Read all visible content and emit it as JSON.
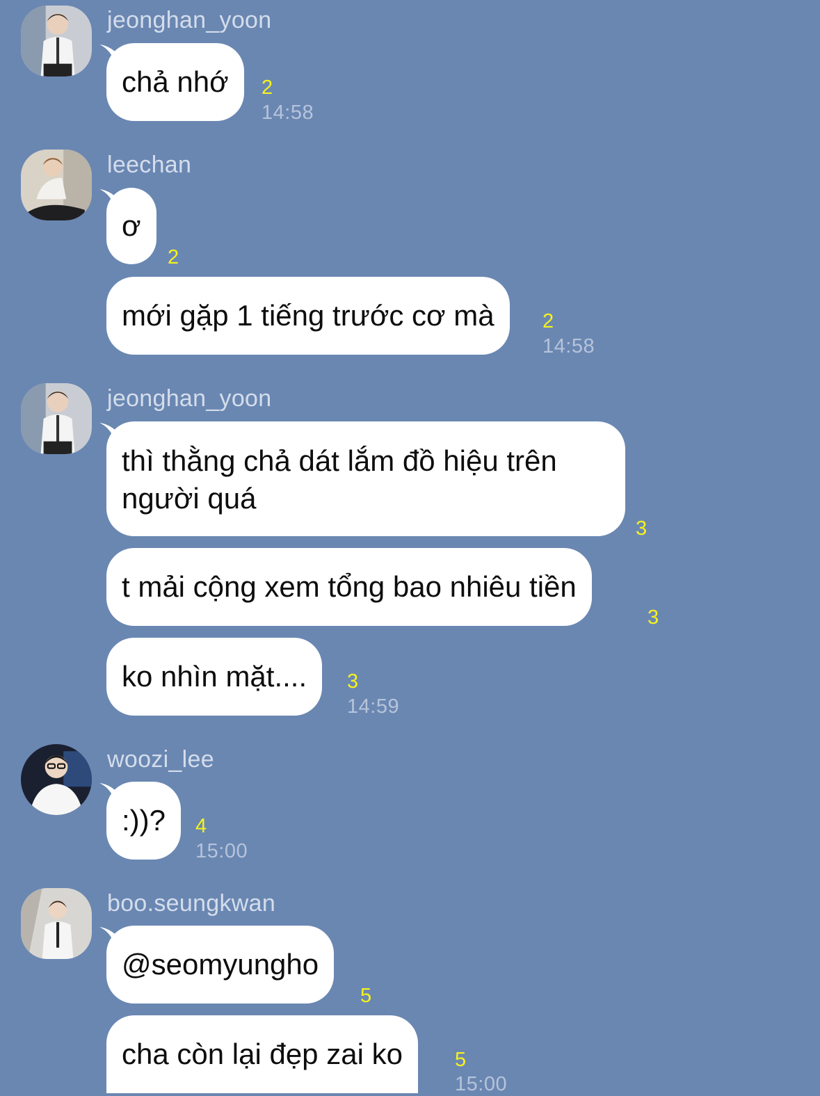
{
  "messages": [
    {
      "user": "jeonghan_yoon",
      "texts": [
        {
          "text": "chả nhớ",
          "count": "2"
        }
      ],
      "time": "14:58"
    },
    {
      "user": "leechan",
      "texts": [
        {
          "text": "ơ",
          "count": "2"
        },
        {
          "text": "mới gặp 1 tiếng trước cơ mà",
          "count": "2"
        }
      ],
      "time": "14:58"
    },
    {
      "user": "jeonghan_yoon",
      "texts": [
        {
          "text": "thì thằng chả dát lắm đồ hiệu trên người quá",
          "count": "3"
        },
        {
          "text": "t mải cộng xem tổng bao nhiêu tiền",
          "count": "3"
        },
        {
          "text": "ko nhìn mặt....",
          "count": "3"
        }
      ],
      "time": "14:59"
    },
    {
      "user": "woozi_lee",
      "texts": [
        {
          "text": ":))?",
          "count": "4"
        }
      ],
      "time": "15:00"
    },
    {
      "user": "boo.seungkwan",
      "texts": [
        {
          "text": "@seomyungho",
          "count": "5"
        },
        {
          "text": "cha còn lại đẹp zai ko",
          "count": "5"
        }
      ],
      "time": "15:00"
    }
  ],
  "colors": {
    "background": "#6a87b2",
    "bubble": "#ffffff",
    "count": "#f7f21c",
    "time": "#b6c4da",
    "name": "#d4ddeb"
  },
  "icons": {
    "avatar": "user-avatar"
  }
}
